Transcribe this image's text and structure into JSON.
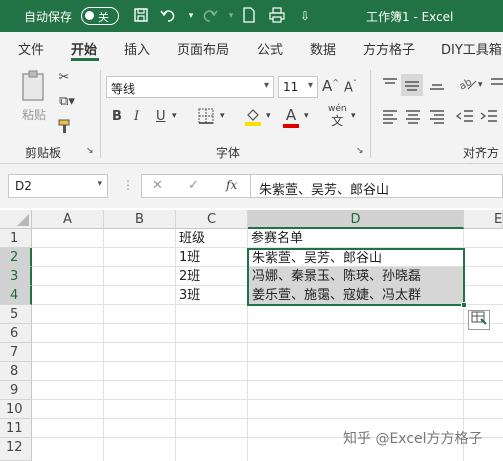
{
  "titlebar": {
    "autosave_label": "自动保存",
    "toggle_label": "关",
    "title": "工作簿1 - Excel"
  },
  "tabs": [
    "文件",
    "开始",
    "插入",
    "页面布局",
    "公式",
    "数据",
    "方方格子",
    "DIY工具箱"
  ],
  "ribbon": {
    "paste_label": "粘贴",
    "clipboard_label": "剪贴板",
    "font_label": "字体",
    "align_label": "对齐方式",
    "font_name": "等线",
    "font_size": "11",
    "bold": "B",
    "italic": "I",
    "underline": "U",
    "grow_font": "A",
    "shrink_font": "A",
    "wen": "wén",
    "wen2": "文"
  },
  "formula_bar": {
    "name_box": "D2",
    "cancel": "✕",
    "enter": "✓",
    "fx": "fx",
    "formula": "朱紫萱、吴芳、郎谷山"
  },
  "grid": {
    "columns": [
      "A",
      "B",
      "C",
      "D",
      "E"
    ],
    "rows": [
      "1",
      "2",
      "3",
      "4",
      "5",
      "6",
      "7",
      "8",
      "9",
      "10",
      "11",
      "12"
    ],
    "cells": {
      "C1": "班级",
      "D1": "参赛名单",
      "C2": "1班",
      "D2": "朱紫萱、吴芳、郎谷山",
      "C3": "2班",
      "D3": "冯娜、秦景玉、陈瑛、孙晓磊",
      "C4": "3班",
      "D4": "姜乐萱、施霭、寇婕、冯太群"
    }
  },
  "watermark": "知乎 @Excel方方格子",
  "colors": {
    "accent": "#217346"
  }
}
